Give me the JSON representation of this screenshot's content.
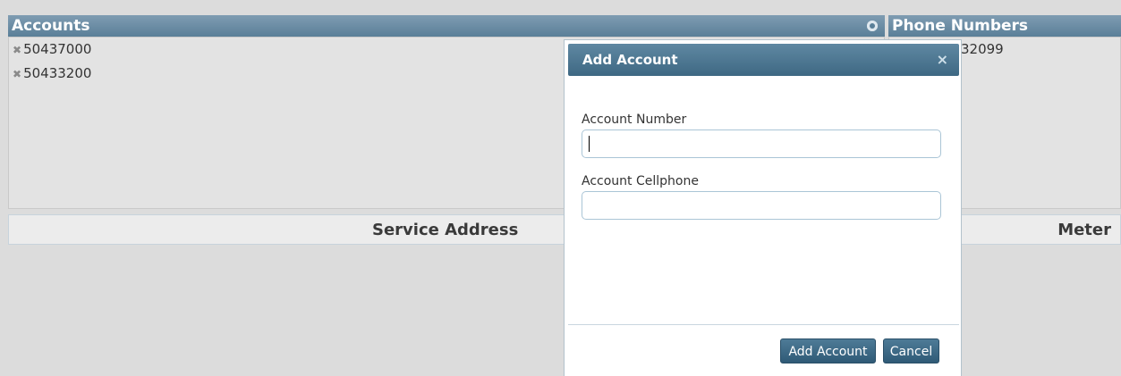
{
  "accounts": {
    "title": "Accounts",
    "items": [
      "50437000",
      "50433200"
    ]
  },
  "phone_numbers": {
    "title": "Phone Numbers",
    "items": [
      "32099"
    ]
  },
  "table": {
    "service_address_header": "Service Address",
    "meter_header": "Meter"
  },
  "modal": {
    "title": "Add Account",
    "close_glyph": "×",
    "account_number_label": "Account Number",
    "account_number_value": "",
    "account_cellphone_label": "Account Cellphone",
    "account_cellphone_value": "",
    "add_button": "Add Account",
    "cancel_button": "Cancel"
  },
  "colors": {
    "header_blue": "#5a7f98",
    "modal_title_blue": "#3e6883",
    "button_blue": "#2f5a76"
  },
  "icons": {
    "accounts_settings": "gear-icon",
    "remove_item": "remove-icon",
    "modal_close": "close-icon"
  }
}
